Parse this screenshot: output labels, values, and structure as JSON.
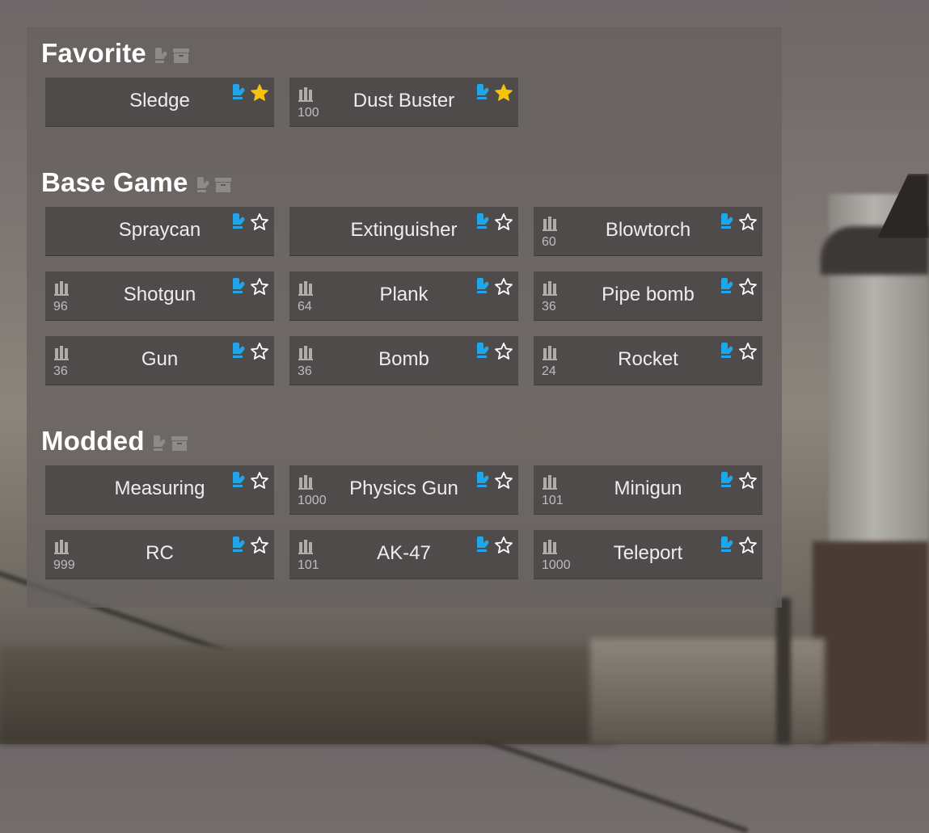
{
  "colors": {
    "accent_blue": "#1ea6ee",
    "star_gold": "#f6c30b",
    "star_outline": "#ffffff",
    "card_bg": "#4f4b4a"
  },
  "icons": {
    "category": [
      "glove-icon",
      "box-icon"
    ],
    "ammo": "ammo-icon",
    "equip": "glove-icon",
    "favorite": "star-icon"
  },
  "sections": [
    {
      "title": "Favorite",
      "items": [
        {
          "name": "Sledge",
          "ammo": "",
          "favorite": true
        },
        {
          "name": "Dust Buster",
          "ammo": "100",
          "favorite": true
        }
      ]
    },
    {
      "title": "Base Game",
      "items": [
        {
          "name": "Spraycan",
          "ammo": "",
          "favorite": false
        },
        {
          "name": "Extinguisher",
          "ammo": "",
          "favorite": false
        },
        {
          "name": "Blowtorch",
          "ammo": "60",
          "favorite": false
        },
        {
          "name": "Shotgun",
          "ammo": "96",
          "favorite": false
        },
        {
          "name": "Plank",
          "ammo": "64",
          "favorite": false
        },
        {
          "name": "Pipe bomb",
          "ammo": "36",
          "favorite": false
        },
        {
          "name": "Gun",
          "ammo": "36",
          "favorite": false
        },
        {
          "name": "Bomb",
          "ammo": "36",
          "favorite": false
        },
        {
          "name": "Rocket",
          "ammo": "24",
          "favorite": false
        }
      ]
    },
    {
      "title": "Modded",
      "items": [
        {
          "name": "Measuring",
          "ammo": "",
          "favorite": false
        },
        {
          "name": "Physics Gun",
          "ammo": "1000",
          "favorite": false
        },
        {
          "name": "Minigun",
          "ammo": "101",
          "favorite": false
        },
        {
          "name": "RC",
          "ammo": "999",
          "favorite": false
        },
        {
          "name": "AK-47",
          "ammo": "101",
          "favorite": false
        },
        {
          "name": "Teleport",
          "ammo": "1000",
          "favorite": false
        }
      ]
    }
  ]
}
